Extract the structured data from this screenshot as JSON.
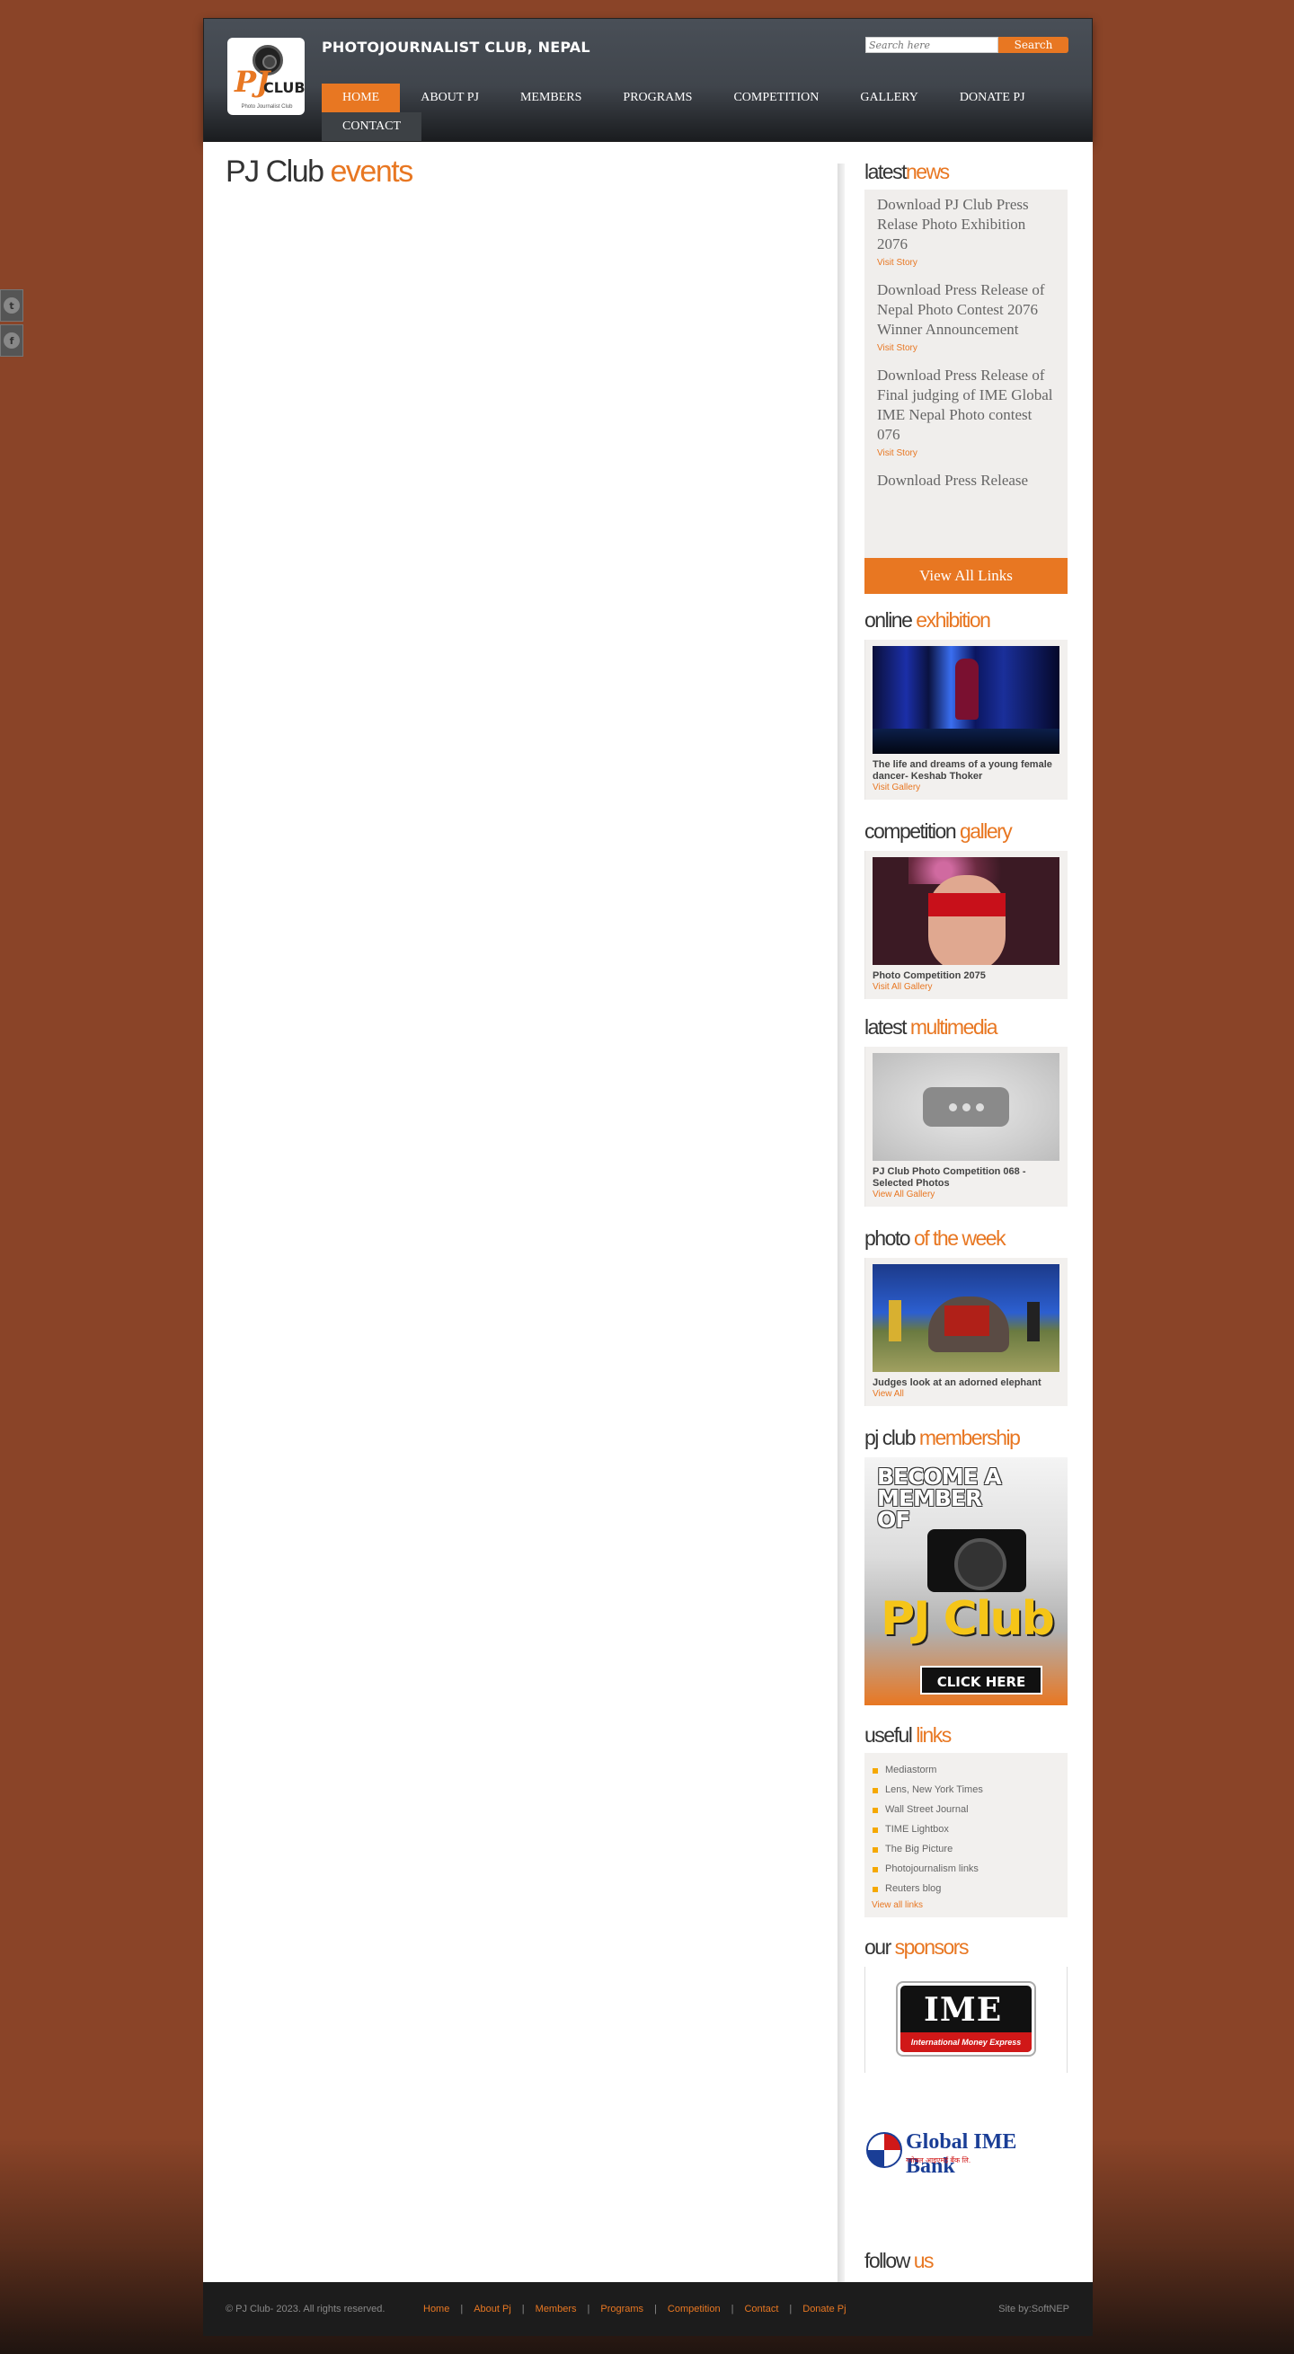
{
  "site": {
    "title": "PHOTOJOURNALIST CLUB, NEPAL",
    "logo": {
      "pj": "PJ",
      "club": "CLUB",
      "sub": "Photo Journalist Club"
    }
  },
  "search": {
    "placeholder": "Search here",
    "button": "Search"
  },
  "nav": [
    {
      "label": "HOME",
      "active": true
    },
    {
      "label": "ABOUT PJ"
    },
    {
      "label": "MEMBERS"
    },
    {
      "label": "PROGRAMS"
    },
    {
      "label": "COMPETITION"
    },
    {
      "label": "GALLERY"
    },
    {
      "label": "DONATE PJ"
    },
    {
      "label": "CONTACT"
    }
  ],
  "social_tabs": [
    "twitter-icon",
    "facebook-icon"
  ],
  "main": {
    "title_a": "PJ Club",
    "title_b": "events"
  },
  "latest_news": {
    "title_a": "latest",
    "title_b": "news",
    "items": [
      {
        "title": "Download PJ Club Press Relase Photo Exhibition 2076",
        "link": "Visit Story"
      },
      {
        "title": "Download Press Release of Nepal Photo Contest 2076 Winner Announcement",
        "link": "Visit Story"
      },
      {
        "title": "Download Press Release of Final judging of IME Global IME Nepal Photo contest 076",
        "link": "Visit Story"
      },
      {
        "title": "Download Press Release",
        "link": ""
      }
    ],
    "view_all": "View All Links"
  },
  "online_exhibition": {
    "title_a": "online",
    "title_b": "exhibition",
    "caption": "The life and dreams of a young female dancer- Keshab Thoker",
    "link": "Visit Gallery"
  },
  "competition_gallery": {
    "title_a": "competition",
    "title_b": "gallery",
    "caption": "Photo Competition 2075",
    "link": "Visit All Gallery"
  },
  "latest_multimedia": {
    "title_a": "latest",
    "title_b": "multimedia",
    "caption": "PJ Club Photo Competition 068 - Selected Photos",
    "link": "View All Gallery"
  },
  "photo_week": {
    "title_a": "photo",
    "title_b": "of the week",
    "caption": "Judges look at an adorned elephant",
    "link": "View All"
  },
  "membership": {
    "title_a": "pj club",
    "title_b": "membership",
    "banner_text": "BECOME A MEMBER OF",
    "banner_club": "PJ Club",
    "banner_button": "CLICK HERE"
  },
  "useful_links": {
    "title_a": "useful",
    "title_b": "links",
    "items": [
      "Mediastorm",
      "Lens, New York Times",
      "Wall Street Journal",
      "TIME Lightbox",
      "The Big Picture",
      "Photojournalism links",
      "Reuters blog"
    ],
    "view_all": "View all links"
  },
  "sponsors": {
    "title_a": "our",
    "title_b": "sponsors",
    "ime_text": "IME",
    "ime_sub": "International Money Express",
    "gime_text": "Global IME Bank",
    "gime_sub": "ग्लोबल आइएमई बैंक लि."
  },
  "follow": {
    "title_a": "follow",
    "title_b": "us"
  },
  "footer": {
    "copy": "© PJ Club- 2023. All rights reserved.",
    "links": [
      "Home",
      "About Pj",
      "Members",
      "Programs",
      "Competition",
      "Contact",
      "Donate Pj"
    ],
    "credit": "Site by:SoftNEP"
  },
  "colors": {
    "accent": "#e87722",
    "background": "#8a4428",
    "header": "#40454c"
  }
}
